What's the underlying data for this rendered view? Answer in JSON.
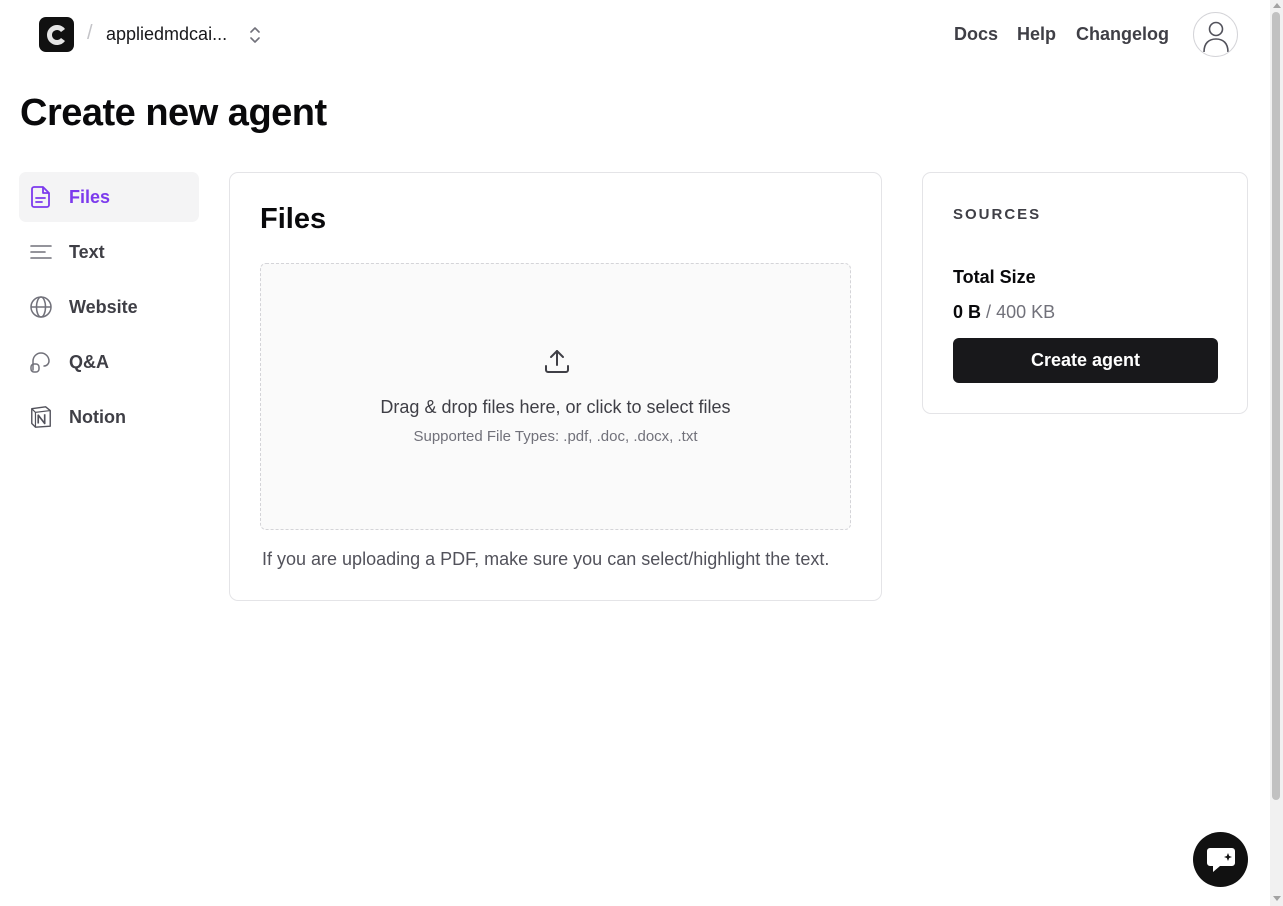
{
  "header": {
    "logo_letter": "C",
    "separator": "/",
    "team_name": "appliedmdcai...",
    "nav_links": [
      "Docs",
      "Help",
      "Changelog"
    ]
  },
  "page": {
    "title": "Create new agent"
  },
  "sidebar": {
    "items": [
      {
        "label": "Files",
        "icon": "file-icon",
        "active": true
      },
      {
        "label": "Text",
        "icon": "text-lines-icon",
        "active": false
      },
      {
        "label": "Website",
        "icon": "globe-icon",
        "active": false
      },
      {
        "label": "Q&A",
        "icon": "chat-qa-icon",
        "active": false
      },
      {
        "label": "Notion",
        "icon": "notion-icon",
        "active": false
      }
    ]
  },
  "files_panel": {
    "title": "Files",
    "dropzone_text": "Drag & drop files here, or click to select files",
    "supported_types": "Supported File Types: .pdf, .doc, .docx, .txt",
    "pdf_note": "If you are uploading a PDF, make sure you can select/highlight the text."
  },
  "sources": {
    "heading": "SOURCES",
    "total_size_label": "Total Size",
    "used": "0 B",
    "separator": "/",
    "limit": "400 KB",
    "create_button": "Create agent"
  },
  "colors": {
    "accent": "#7c3aed",
    "primary_button": "#18181b",
    "border": "#e4e4e7"
  }
}
